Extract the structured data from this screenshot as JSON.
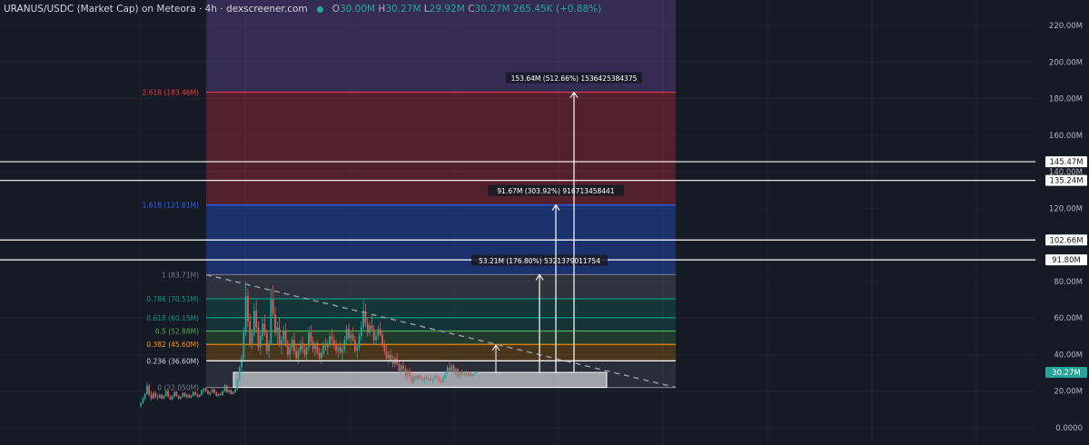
{
  "header": {
    "title": "URANUS/USDC (Market Cap) on Meteora · 4h · dexscreener.com",
    "ohlc": [
      {
        "k": "O",
        "v": "30.00M"
      },
      {
        "k": "H",
        "v": "30.27M"
      },
      {
        "k": "L",
        "v": "29.92M"
      },
      {
        "k": "C",
        "v": "30.27M"
      }
    ],
    "change": "265.45K (+0.88%)"
  },
  "colors": {
    "background": "#161a25",
    "up": "#26a69a",
    "down": "#ef5350",
    "fib_2618": "#f23645",
    "fib_1618": "#2962ff",
    "fib_1": "#787b86",
    "fib_0786": "#089981",
    "fib_0618": "#089981",
    "fib_05": "#4caf50",
    "fib_0382": "#ff9800",
    "fib_0236": "#d1d4dc",
    "fib_0": "#787b86"
  },
  "chart_data": {
    "type": "candlestick",
    "title": "URANUS/USDC (Market Cap) on Meteora · 4h · dexscreener.com",
    "ylim": [
      0,
      230
    ],
    "y_unit": "M",
    "y_ticks": [
      "220.00M",
      "200.00M",
      "180.00M",
      "160.00M",
      "140.00M",
      "120.00M",
      "80.00M",
      "60.00M",
      "40.00M",
      "20.00M",
      "0.0000"
    ],
    "y_tick_values": [
      220,
      200,
      180,
      160,
      140,
      120,
      80,
      60,
      40,
      20,
      0
    ],
    "fib_levels": [
      {
        "ratio": 2.618,
        "label": "2.618 (183.46M)",
        "value": 183.46
      },
      {
        "ratio": 1.618,
        "label": "1.618 (121.81M)",
        "value": 121.81
      },
      {
        "ratio": 1,
        "label": "1 (83.71M)",
        "value": 83.71
      },
      {
        "ratio": 0.786,
        "label": "0.786 (70.51M)",
        "value": 70.51
      },
      {
        "ratio": 0.618,
        "label": "0.618 (60.15M)",
        "value": 60.15
      },
      {
        "ratio": 0.5,
        "label": "0.5 (52.88M)",
        "value": 52.88
      },
      {
        "ratio": 0.382,
        "label": "0.382 (45.60M)",
        "value": 45.6
      },
      {
        "ratio": 0.236,
        "label": "0.236 (36.60M)",
        "value": 36.6
      },
      {
        "ratio": 0,
        "label": "0 (22.050M)",
        "value": 22.05
      }
    ],
    "horizontal_lines": [
      {
        "value": 145.47,
        "label": "145.47M"
      },
      {
        "value": 135.24,
        "label": "135.24M"
      },
      {
        "value": 102.66,
        "label": "102.66M"
      },
      {
        "value": 91.8,
        "label": "91.80M"
      }
    ],
    "last_price": {
      "value": 30.27,
      "label": "30.27M"
    },
    "measurements": [
      {
        "from": 30.27,
        "to": 83.71,
        "label": "53.21M (176.80%) 5321379011754"
      },
      {
        "from": 30.27,
        "to": 121.81,
        "label": "91.67M (303.92%) 916713458441"
      },
      {
        "from": 30.27,
        "to": 183.46,
        "label": "153.64M (512.66%) 1536425384375"
      }
    ],
    "support_box": {
      "bottom": 22.05,
      "top": 30.27
    },
    "trendline": {
      "from": 83.71,
      "to": 22.05
    },
    "candles": [
      [
        12.0,
        14.0,
        11.0,
        13.5
      ],
      [
        13.5,
        17.0,
        13.0,
        16.0
      ],
      [
        16.0,
        19.0,
        15.0,
        18.5
      ],
      [
        18.5,
        25.0,
        18.0,
        23.0
      ],
      [
        23.0,
        24.0,
        17.0,
        18.0
      ],
      [
        18.0,
        20.0,
        15.0,
        16.0
      ],
      [
        16.0,
        20.0,
        15.5,
        19.0
      ],
      [
        19.0,
        20.0,
        16.0,
        17.0
      ],
      [
        17.0,
        18.5,
        15.0,
        16.5
      ],
      [
        16.5,
        19.0,
        16.0,
        18.0
      ],
      [
        18.0,
        18.5,
        15.5,
        16.0
      ],
      [
        16.0,
        18.0,
        15.5,
        17.5
      ],
      [
        17.5,
        21.0,
        17.0,
        20.0
      ],
      [
        20.0,
        20.5,
        16.5,
        17.0
      ],
      [
        17.0,
        18.0,
        15.0,
        15.5
      ],
      [
        15.5,
        18.0,
        15.0,
        17.0
      ],
      [
        17.0,
        20.0,
        16.5,
        19.5
      ],
      [
        19.5,
        20.0,
        17.0,
        17.5
      ],
      [
        17.5,
        18.0,
        15.5,
        16.0
      ],
      [
        16.0,
        17.5,
        15.0,
        17.0
      ],
      [
        17.0,
        19.5,
        16.5,
        19.0
      ],
      [
        19.0,
        19.5,
        16.5,
        17.0
      ],
      [
        17.0,
        18.5,
        16.0,
        18.0
      ],
      [
        18.0,
        18.5,
        16.0,
        16.5
      ],
      [
        16.5,
        18.0,
        16.0,
        17.5
      ],
      [
        17.5,
        20.0,
        17.0,
        19.5
      ],
      [
        19.5,
        20.0,
        17.5,
        18.0
      ],
      [
        18.0,
        19.0,
        16.5,
        17.0
      ],
      [
        17.0,
        18.5,
        16.5,
        18.0
      ],
      [
        18.0,
        21.0,
        17.5,
        20.5
      ],
      [
        20.5,
        22.0,
        19.0,
        21.5
      ],
      [
        21.5,
        22.0,
        19.5,
        20.0
      ],
      [
        20.0,
        21.0,
        18.0,
        18.5
      ],
      [
        18.5,
        20.0,
        17.5,
        19.5
      ],
      [
        19.5,
        22.0,
        19.0,
        21.0
      ],
      [
        21.0,
        21.5,
        18.5,
        19.0
      ],
      [
        19.0,
        20.0,
        17.0,
        17.5
      ],
      [
        17.5,
        19.0,
        17.0,
        18.5
      ],
      [
        18.5,
        19.5,
        17.5,
        18.0
      ],
      [
        18.0,
        20.5,
        17.5,
        20.0
      ],
      [
        20.0,
        24.0,
        19.5,
        23.0
      ],
      [
        23.0,
        23.5,
        19.0,
        19.5
      ],
      [
        19.5,
        21.0,
        18.5,
        20.5
      ],
      [
        20.5,
        21.0,
        18.0,
        18.5
      ],
      [
        18.5,
        20.0,
        18.0,
        19.5
      ],
      [
        19.5,
        21.5,
        19.0,
        21.0
      ],
      [
        21.0,
        27.0,
        20.5,
        26.0
      ],
      [
        26.0,
        34.0,
        25.0,
        33.0
      ],
      [
        33.0,
        40.0,
        30.0,
        38.0
      ],
      [
        38.0,
        55.0,
        36.0,
        52.0
      ],
      [
        52.0,
        80.0,
        50.0,
        72.0
      ],
      [
        72.0,
        76.0,
        55.0,
        58.0
      ],
      [
        58.0,
        62.0,
        44.0,
        46.0
      ],
      [
        46.0,
        54.0,
        43.0,
        52.0
      ],
      [
        52.0,
        68.0,
        50.0,
        64.0
      ],
      [
        64.0,
        70.0,
        52.0,
        55.0
      ],
      [
        55.0,
        58.0,
        42.0,
        44.0
      ],
      [
        44.0,
        52.0,
        40.0,
        50.0
      ],
      [
        50.0,
        60.0,
        48.0,
        57.0
      ],
      [
        57.0,
        62.0,
        50.0,
        52.0
      ],
      [
        52.0,
        54.0,
        40.0,
        42.0
      ],
      [
        42.0,
        48.0,
        38.0,
        46.0
      ],
      [
        46.0,
        76.0,
        45.0,
        70.0
      ],
      [
        70.0,
        78.0,
        60.0,
        62.0
      ],
      [
        62.0,
        66.0,
        50.0,
        52.0
      ],
      [
        52.0,
        58.0,
        46.0,
        55.0
      ],
      [
        55.0,
        60.0,
        44.0,
        46.0
      ],
      [
        46.0,
        50.0,
        40.0,
        48.0
      ],
      [
        48.0,
        56.0,
        45.0,
        53.0
      ],
      [
        53.0,
        57.0,
        44.0,
        45.0
      ],
      [
        45.0,
        48.0,
        38.0,
        40.0
      ],
      [
        40.0,
        46.0,
        37.0,
        44.0
      ],
      [
        44.0,
        50.0,
        42.0,
        48.0
      ],
      [
        48.0,
        52.0,
        40.0,
        42.0
      ],
      [
        42.0,
        45.0,
        36.0,
        38.0
      ],
      [
        38.0,
        44.0,
        35.0,
        42.0
      ],
      [
        42.0,
        48.0,
        40.0,
        46.0
      ],
      [
        46.0,
        50.0,
        41.0,
        43.0
      ],
      [
        43.0,
        46.0,
        38.0,
        40.0
      ],
      [
        40.0,
        45.0,
        36.0,
        44.0
      ],
      [
        44.0,
        55.0,
        42.0,
        52.0
      ],
      [
        52.0,
        56.0,
        45.0,
        47.0
      ],
      [
        47.0,
        50.0,
        41.0,
        43.0
      ],
      [
        43.0,
        47.0,
        39.0,
        45.0
      ],
      [
        45.0,
        48.0,
        40.0,
        41.0
      ],
      [
        41.0,
        44.0,
        36.0,
        38.0
      ],
      [
        38.0,
        43.0,
        35.0,
        41.0
      ],
      [
        41.0,
        47.0,
        39.0,
        45.0
      ],
      [
        45.0,
        49.0,
        42.0,
        44.0
      ],
      [
        44.0,
        48.0,
        40.0,
        46.0
      ],
      [
        46.0,
        52.0,
        44.0,
        50.0
      ],
      [
        50.0,
        54.0,
        46.0,
        48.0
      ],
      [
        48.0,
        51.0,
        43.0,
        45.0
      ],
      [
        45.0,
        48.0,
        40.0,
        42.0
      ],
      [
        42.0,
        46.0,
        38.0,
        44.0
      ],
      [
        44.0,
        47.0,
        40.0,
        41.0
      ],
      [
        41.0,
        45.0,
        37.0,
        43.0
      ],
      [
        43.0,
        50.0,
        41.0,
        48.0
      ],
      [
        48.0,
        56.0,
        46.0,
        54.0
      ],
      [
        54.0,
        57.0,
        47.0,
        49.0
      ],
      [
        49.0,
        53.0,
        45.0,
        51.0
      ],
      [
        51.0,
        55.0,
        47.0,
        48.0
      ],
      [
        48.0,
        50.0,
        41.0,
        42.0
      ],
      [
        42.0,
        46.0,
        38.0,
        44.0
      ],
      [
        44.0,
        52.0,
        42.0,
        50.0
      ],
      [
        50.0,
        58.0,
        48.0,
        55.0
      ],
      [
        55.0,
        70.0,
        53.0,
        64.0
      ],
      [
        64.0,
        68.0,
        55.0,
        57.0
      ],
      [
        57.0,
        60.0,
        50.0,
        52.0
      ],
      [
        52.0,
        58.0,
        50.0,
        56.0
      ],
      [
        56.0,
        62.0,
        53.0,
        54.0
      ],
      [
        54.0,
        56.0,
        46.0,
        48.0
      ],
      [
        48.0,
        52.0,
        45.0,
        50.0
      ],
      [
        50.0,
        56.0,
        48.0,
        54.0
      ],
      [
        54.0,
        58.0,
        50.0,
        51.0
      ],
      [
        51.0,
        53.0,
        44.0,
        45.0
      ],
      [
        45.0,
        48.0,
        40.0,
        42.0
      ],
      [
        42.0,
        45.0,
        37.0,
        38.0
      ],
      [
        38.0,
        42.0,
        35.0,
        40.0
      ],
      [
        40.0,
        43.0,
        36.0,
        37.0
      ],
      [
        37.0,
        40.0,
        33.0,
        35.0
      ],
      [
        35.0,
        39.0,
        33.0,
        38.0
      ],
      [
        38.0,
        41.0,
        34.0,
        35.0
      ],
      [
        35.0,
        37.0,
        30.0,
        31.0
      ],
      [
        31.0,
        35.0,
        29.0,
        34.0
      ],
      [
        34.0,
        37.0,
        31.0,
        32.0
      ],
      [
        32.0,
        34.0,
        27.0,
        28.0
      ],
      [
        28.0,
        32.0,
        26.0,
        31.0
      ],
      [
        31.0,
        33.0,
        27.0,
        28.0
      ],
      [
        28.0,
        30.0,
        24.0,
        25.0
      ],
      [
        25.0,
        29.0,
        24.0,
        28.0
      ],
      [
        28.0,
        30.0,
        26.0,
        27.0
      ],
      [
        27.0,
        29.0,
        25.0,
        28.5
      ],
      [
        28.5,
        30.0,
        26.5,
        27.0
      ],
      [
        27.0,
        28.0,
        25.0,
        26.0
      ],
      [
        26.0,
        28.0,
        24.5,
        27.5
      ],
      [
        27.5,
        29.0,
        26.0,
        26.5
      ],
      [
        26.5,
        28.0,
        25.0,
        27.0
      ],
      [
        27.0,
        28.5,
        25.5,
        26.0
      ],
      [
        26.0,
        27.5,
        24.5,
        27.0
      ],
      [
        27.0,
        29.0,
        26.0,
        28.0
      ],
      [
        28.0,
        29.5,
        26.5,
        27.0
      ],
      [
        27.0,
        28.0,
        25.0,
        26.0
      ],
      [
        26.0,
        27.0,
        24.0,
        25.0
      ],
      [
        25.0,
        28.0,
        24.5,
        27.0
      ],
      [
        27.0,
        31.0,
        26.5,
        30.0
      ],
      [
        30.0,
        34.0,
        29.0,
        33.0
      ],
      [
        33.0,
        36.0,
        30.0,
        31.0
      ],
      [
        31.0,
        35.0,
        30.0,
        34.0
      ],
      [
        34.0,
        35.0,
        29.0,
        30.0
      ],
      [
        30.0,
        33.0,
        28.0,
        32.0
      ],
      [
        32.0,
        33.0,
        27.0,
        28.0
      ],
      [
        28.0,
        31.0,
        27.0,
        30.5
      ],
      [
        30.5,
        32.0,
        28.5,
        29.0
      ],
      [
        29.0,
        31.0,
        28.0,
        30.0
      ],
      [
        30.0,
        31.0,
        28.0,
        28.5
      ],
      [
        28.5,
        30.5,
        28.0,
        30.0
      ],
      [
        30.0,
        30.5,
        28.0,
        28.5
      ],
      [
        28.5,
        30.0,
        27.5,
        29.5
      ],
      [
        29.5,
        30.5,
        28.5,
        30.0
      ],
      [
        30.0,
        30.27,
        29.92,
        30.27
      ]
    ]
  }
}
